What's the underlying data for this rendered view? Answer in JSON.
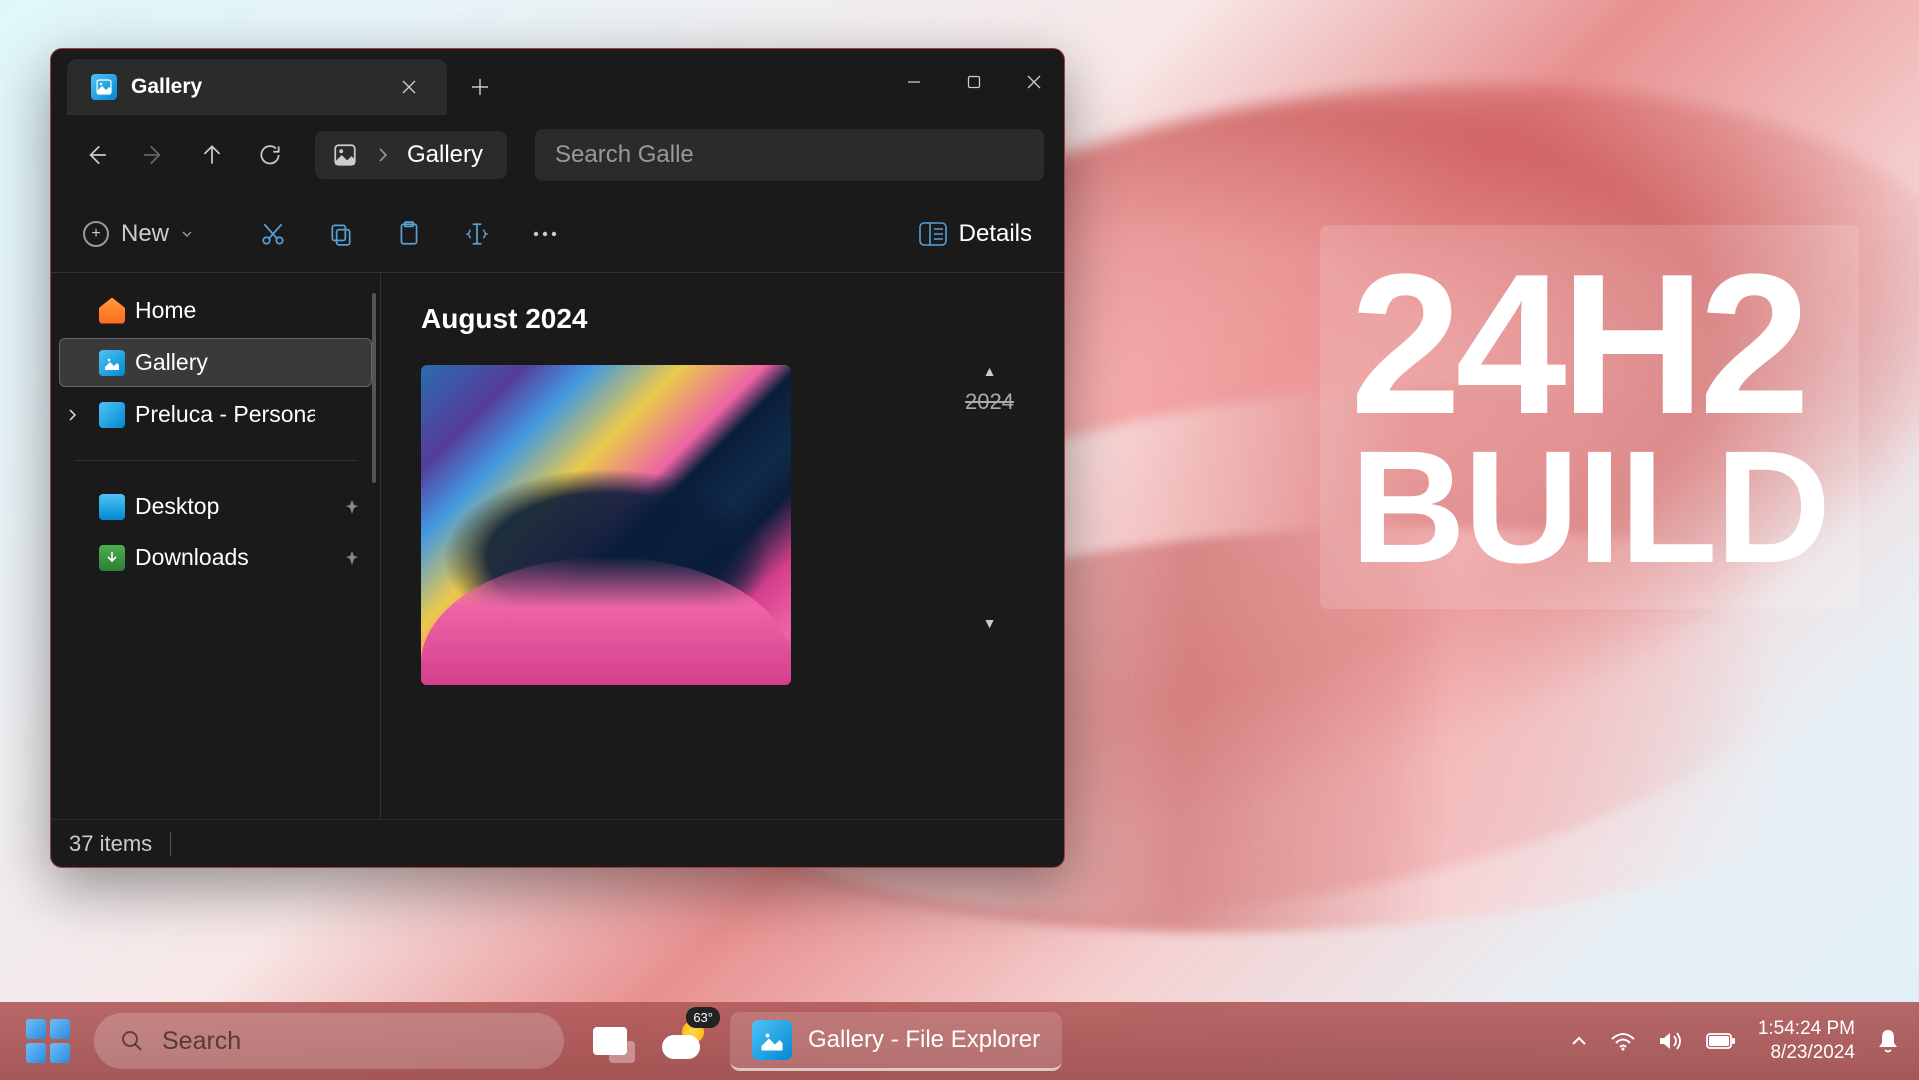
{
  "window": {
    "tab_title": "Gallery",
    "breadcrumb": "Gallery",
    "search_placeholder": "Search Galle",
    "toolbar": {
      "new_label": "New",
      "view_label": "Details"
    },
    "sidebar": {
      "home": "Home",
      "gallery": "Gallery",
      "onedrive": "Preluca - Persona",
      "desktop": "Desktop",
      "downloads": "Downloads"
    },
    "content": {
      "section": "August 2024",
      "timeline_year": "2024"
    },
    "status": "37 items"
  },
  "overlay": {
    "line1": "24H2",
    "line2": "BUILD"
  },
  "taskbar": {
    "search": "Search",
    "weather_temp": "63°",
    "app_label": "Gallery - File Explorer",
    "time": "1:54:24 PM",
    "date": "8/23/2024"
  }
}
